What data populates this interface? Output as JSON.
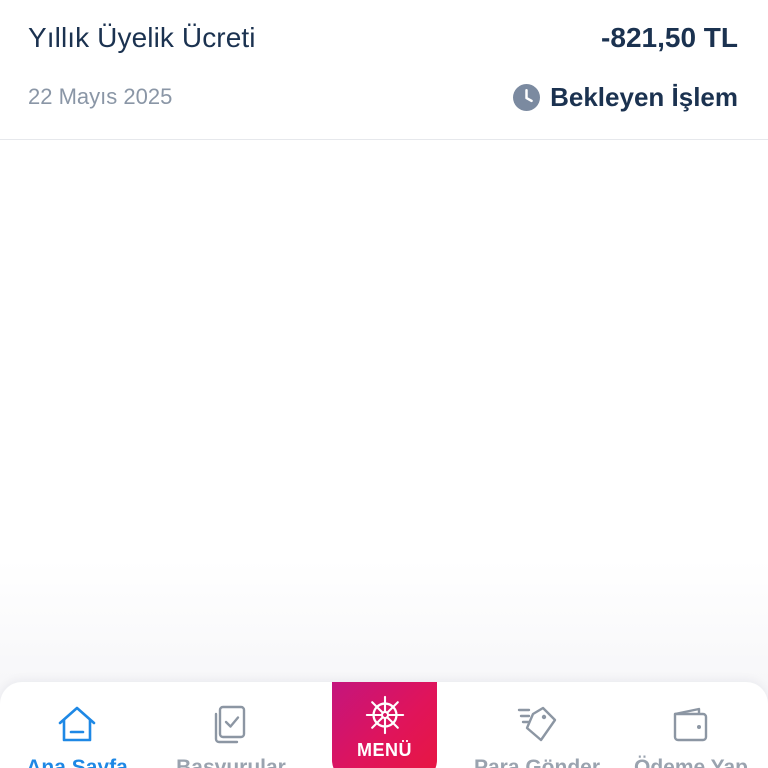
{
  "transaction": {
    "title": "Yıllık Üyelik Ücreti",
    "amount": "-821,50 TL",
    "date": "22 Mayıs 2025",
    "status": "Bekleyen İşlem",
    "status_icon": "clock-icon"
  },
  "bottom_nav": {
    "items": [
      {
        "label": "Ana Sayfa",
        "icon": "home-icon",
        "active": true
      },
      {
        "label": "Başvurular",
        "icon": "documents-check-icon",
        "active": false
      },
      {
        "label": "Para Gönder",
        "icon": "send-tag-icon",
        "active": false
      },
      {
        "label": "Ödeme Yap",
        "icon": "wallet-icon",
        "active": false
      }
    ],
    "menu": {
      "label": "MENÜ",
      "icon": "ship-wheel-icon"
    }
  },
  "colors": {
    "text_primary": "#1b3250",
    "text_secondary": "#8a96a6",
    "nav_active": "#1e88e5",
    "nav_inactive": "#9aa3af",
    "menu_gradient_start": "#c4157d",
    "menu_gradient_end": "#e8173f"
  }
}
